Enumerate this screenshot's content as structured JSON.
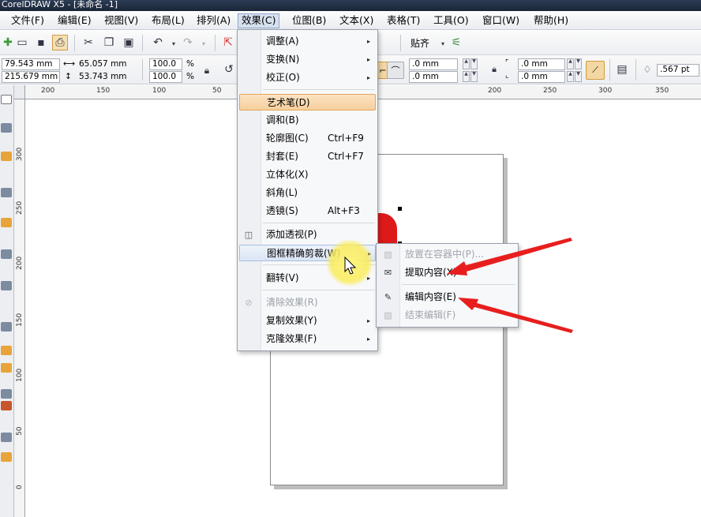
{
  "window": {
    "title": "CorelDRAW X5 - [未命名 -1]"
  },
  "menubar": {
    "items": [
      {
        "label": "文件(F)"
      },
      {
        "label": "编辑(E)"
      },
      {
        "label": "视图(V)"
      },
      {
        "label": "布局(L)"
      },
      {
        "label": "排列(A)"
      },
      {
        "label": "效果(C)"
      },
      {
        "label": "位图(B)"
      },
      {
        "label": "文本(X)"
      },
      {
        "label": "表格(T)"
      },
      {
        "label": "工具(O)"
      },
      {
        "label": "窗口(W)"
      },
      {
        "label": "帮助(H)"
      }
    ]
  },
  "toolbar": {
    "snap_label": "贴齐"
  },
  "propertybar": {
    "x": "79.543 mm",
    "y": "215.679 mm",
    "width": "65.057 mm",
    "height": "53.743 mm",
    "scale_x": "100.0",
    "scale_y": "100.0",
    "percent": "%",
    "corner1": ".0 mm",
    "corner2": ".0 mm",
    "corner3": ".0 mm",
    "corner4": ".0 mm",
    "outline": ".567 pt"
  },
  "ruler": {
    "top": [
      "200",
      "150",
      "100",
      "50",
      "200",
      "250",
      "300",
      "350"
    ],
    "left": [
      "300",
      "250",
      "200",
      "150",
      "100",
      "50",
      "0"
    ]
  },
  "effects_menu": {
    "items": [
      {
        "label": "调整(A)",
        "arrow": "▸"
      },
      {
        "label": "变换(N)",
        "arrow": "▸"
      },
      {
        "label": "校正(O)",
        "arrow": "▸"
      },
      {
        "label": "艺术笔(D)"
      },
      {
        "label": "调和(B)"
      },
      {
        "label": "轮廓图(C)",
        "shortcut": "Ctrl+F9"
      },
      {
        "label": "封套(E)",
        "shortcut": "Ctrl+F7"
      },
      {
        "label": "立体化(X)"
      },
      {
        "label": "斜角(L)"
      },
      {
        "label": "透镜(S)",
        "shortcut": "Alt+F3"
      },
      {
        "label": "添加透视(P)"
      },
      {
        "label": "图框精确剪裁(W)",
        "arrow": "▸"
      },
      {
        "label": "翻转(V)",
        "arrow": "▸"
      },
      {
        "label": "清除效果(R)"
      },
      {
        "label": "复制效果(Y)",
        "arrow": "▸"
      },
      {
        "label": "克隆效果(F)",
        "arrow": "▸"
      }
    ]
  },
  "powerclip_submenu": {
    "items": [
      {
        "label": "放置在容器中(P)...",
        "enabled": false
      },
      {
        "label": "提取内容(X)",
        "enabled": true
      },
      {
        "label": "编辑内容(E)",
        "enabled": true
      },
      {
        "label": "结束编辑(F)",
        "enabled": false
      }
    ]
  },
  "colors": {
    "annotation_arrow": "#e81e1e",
    "highlight": "#f6cf9d",
    "object_fill": "#dd1a1a"
  }
}
